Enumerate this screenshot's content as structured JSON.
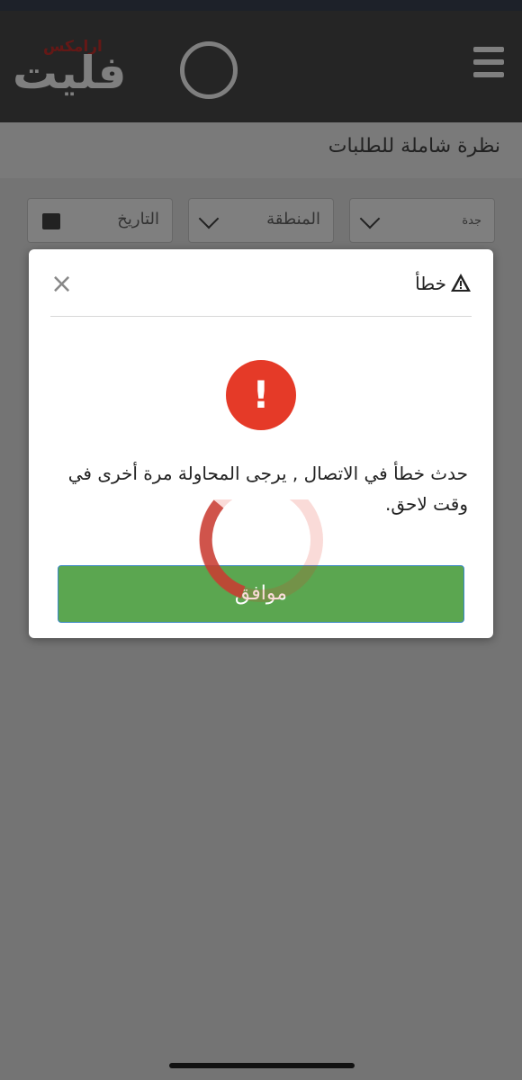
{
  "header": {
    "logo_text": "فليت",
    "logo_sub": "ارامكس",
    "menu_icon": "hamburger-menu-icon"
  },
  "page": {
    "title": "نظرة شاملة للطلبات"
  },
  "filters": {
    "city": "جدة",
    "region": "المنطقة",
    "date": "التاريخ"
  },
  "modal": {
    "title": "خطأ",
    "title_icon": "warning-triangle-icon",
    "close_icon": "close-icon",
    "close_glyph": "×",
    "error_icon_glyph": "!",
    "message": "حدث خطأ في الاتصال , يرجى المحاولة مرة أخرى في وقت لاحق.",
    "ok_label": "موافق"
  },
  "colors": {
    "header_bg": "#4a4a4a",
    "error_red": "#e53a28",
    "ok_green": "#5ba650",
    "brand_red": "#c9302c"
  }
}
